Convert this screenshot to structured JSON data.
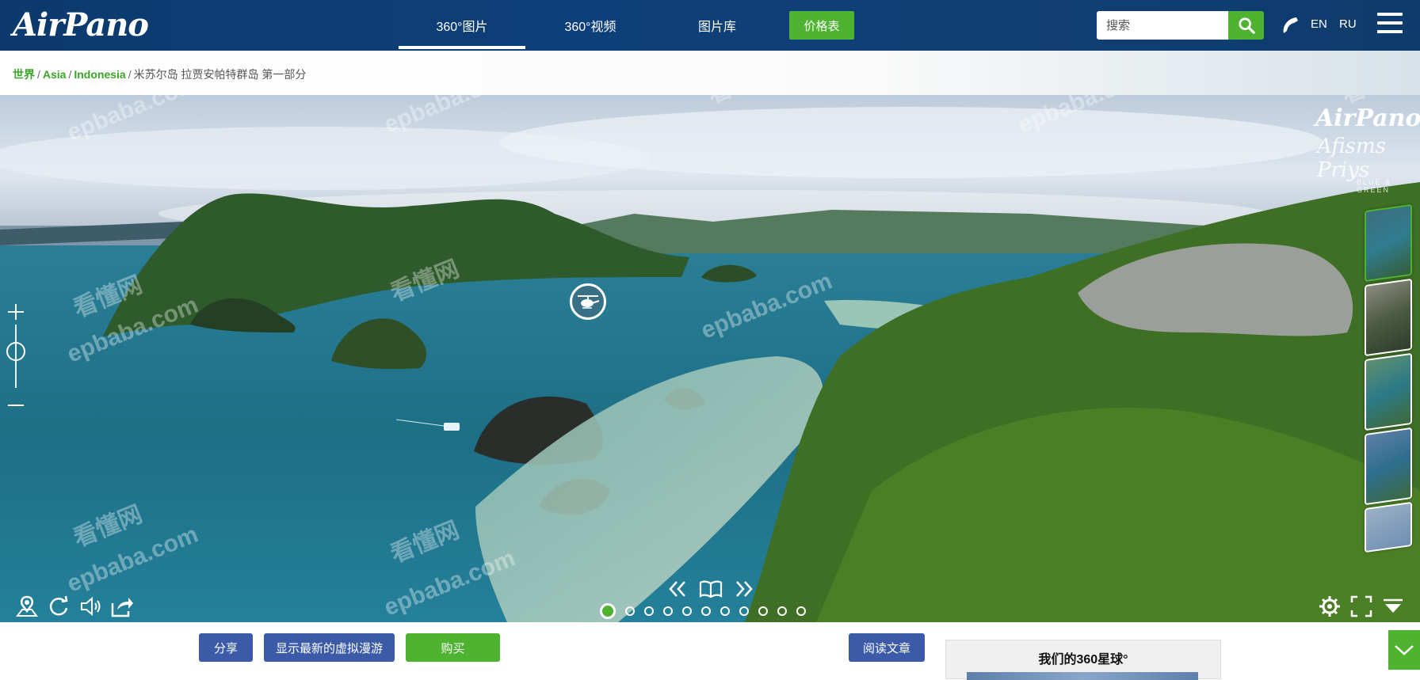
{
  "header": {
    "logo": "AirPano",
    "tabs": [
      {
        "label": "360°图片",
        "active": true
      },
      {
        "label": "360°视频",
        "active": false
      },
      {
        "label": "图片库",
        "active": false
      }
    ],
    "price_button": "价格表",
    "search": {
      "placeholder": "搜索"
    },
    "languages": [
      "EN",
      "RU"
    ]
  },
  "breadcrumb": {
    "items": [
      "世界",
      "Asia",
      "Indonesia"
    ],
    "current": "米苏尔岛 拉贾安帕特群岛 第一部分"
  },
  "watermark": {
    "cn": "看懂网",
    "en": "epbaba.com"
  },
  "pano": {
    "brand": "AirPano",
    "signature": "Afisms Priys",
    "signature_sub": "BLUE & GREEN",
    "dots_count": 11,
    "active_dot": 0
  },
  "bottom": {
    "share": "分享",
    "latest_tours": "显示最新的虚拟漫游",
    "buy": "购买",
    "read_article": "阅读文章",
    "planet_title": "我们的360星球°"
  },
  "colors": {
    "nav_bg": "#0d3f78",
    "accent_green": "#4db330",
    "button_blue": "#3b5ba8",
    "link_green": "#3aa526"
  }
}
